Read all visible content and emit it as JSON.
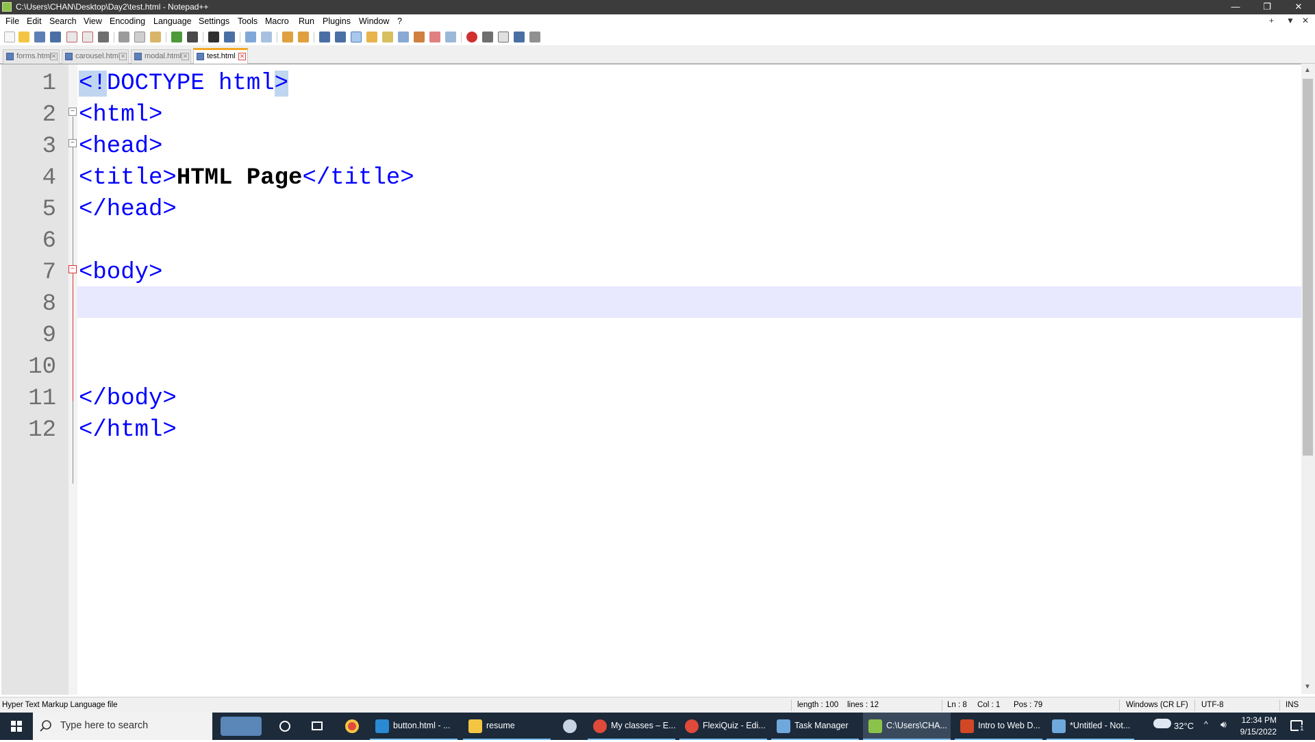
{
  "window": {
    "title": "C:\\Users\\CHAN\\Desktop\\Day2\\test.html - Notepad++",
    "minimize_glyph": "—",
    "restore_glyph": "❐",
    "close_glyph": "✕"
  },
  "menu": {
    "items": [
      "File",
      "Edit",
      "Search",
      "View",
      "Encoding",
      "Language",
      "Settings",
      "Tools",
      "Macro",
      "Run",
      "Plugins",
      "Window",
      "?"
    ],
    "right_controls": [
      "+",
      "▼",
      "✕"
    ]
  },
  "tabs": [
    {
      "label": "forms.html",
      "active": false
    },
    {
      "label": "carousel.html",
      "active": false
    },
    {
      "label": "modal.html",
      "active": false
    },
    {
      "label": "test.html",
      "active": true
    }
  ],
  "editor": {
    "lines": [
      {
        "num": "1",
        "pre": "",
        "sel": "<!",
        "mid": "DOCTYPE html",
        "sel2": ">",
        "post": ""
      },
      {
        "num": "2",
        "pre": "<html>",
        "bold": "",
        "post": ""
      },
      {
        "num": "3",
        "pre": "<head>",
        "bold": "",
        "post": ""
      },
      {
        "num": "4",
        "pre": "<title>",
        "bold": "HTML Page",
        "post": "</title>"
      },
      {
        "num": "5",
        "pre": "</head>",
        "bold": "",
        "post": ""
      },
      {
        "num": "6",
        "pre": "",
        "bold": "",
        "post": ""
      },
      {
        "num": "7",
        "pre": "<body>",
        "bold": "",
        "post": ""
      },
      {
        "num": "8",
        "pre": "",
        "bold": "",
        "post": ""
      },
      {
        "num": "9",
        "pre": "",
        "bold": "",
        "post": ""
      },
      {
        "num": "10",
        "pre": "",
        "bold": "",
        "post": ""
      },
      {
        "num": "11",
        "pre": "</body>",
        "bold": "",
        "post": ""
      },
      {
        "num": "12",
        "pre": "</html>",
        "bold": "",
        "post": ""
      }
    ],
    "current_line": 8
  },
  "status": {
    "file_type": "Hyper Text Markup Language file",
    "length": "length : 100",
    "lines": "lines : 12",
    "ln": "Ln : 8",
    "col": "Col : 1",
    "pos": "Pos : 79",
    "eol": "Windows (CR LF)",
    "encoding": "UTF-8",
    "mode": "INS"
  },
  "taskbar": {
    "search_placeholder": "Type here to search",
    "apps": [
      {
        "label": "button.html - ...",
        "icon": "vscode-icon",
        "color": "#2a8ad4"
      },
      {
        "label": "resume",
        "icon": "folder-icon",
        "color": "#f4c542"
      },
      {
        "label": "My classes – E...",
        "icon": "chrome-icon",
        "color": "#e04a3a"
      },
      {
        "label": "FlexiQuiz - Edi...",
        "icon": "chrome-icon",
        "color": "#e04a3a"
      },
      {
        "label": "Task Manager",
        "icon": "task-manager-icon",
        "color": "#6fa8dc"
      },
      {
        "label": "C:\\Users\\CHA...",
        "icon": "notepadpp-icon",
        "color": "#8bc34a"
      },
      {
        "label": "Intro to Web D...",
        "icon": "powerpoint-icon",
        "color": "#d24726"
      },
      {
        "label": "*Untitled - Not...",
        "icon": "notepad-icon",
        "color": "#6fa8dc"
      }
    ],
    "weather": "32°C",
    "time": "12:34 PM",
    "date": "9/15/2022",
    "notification_count": "1"
  }
}
